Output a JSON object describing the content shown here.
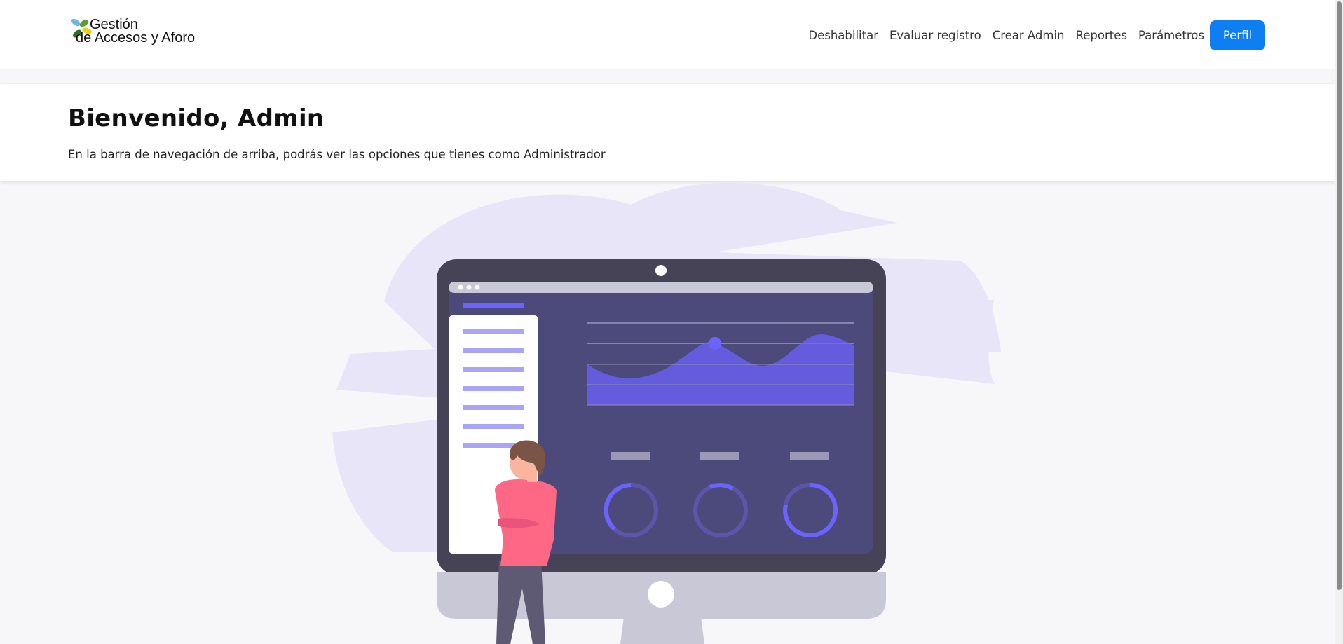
{
  "brand": {
    "line1": "Gestión",
    "line2": "de Accesos y Aforo",
    "logo_icon": "leaves-logo-icon"
  },
  "nav": {
    "links": [
      "Deshabilitar",
      "Evaluar registro",
      "Crear Admin",
      "Reportes",
      "Parámetros"
    ],
    "profile_button": "Perfil"
  },
  "hero": {
    "title": "Bienvenido, Admin",
    "subtitle": "En la barra de navegación de arriba, podrás ver las opciones que tienes como Administrador"
  },
  "colors": {
    "primary": "#0d7ff3",
    "illustration_accent": "#6c63ff",
    "monitor_dark": "#464356",
    "person_shirt": "#ff6884"
  }
}
